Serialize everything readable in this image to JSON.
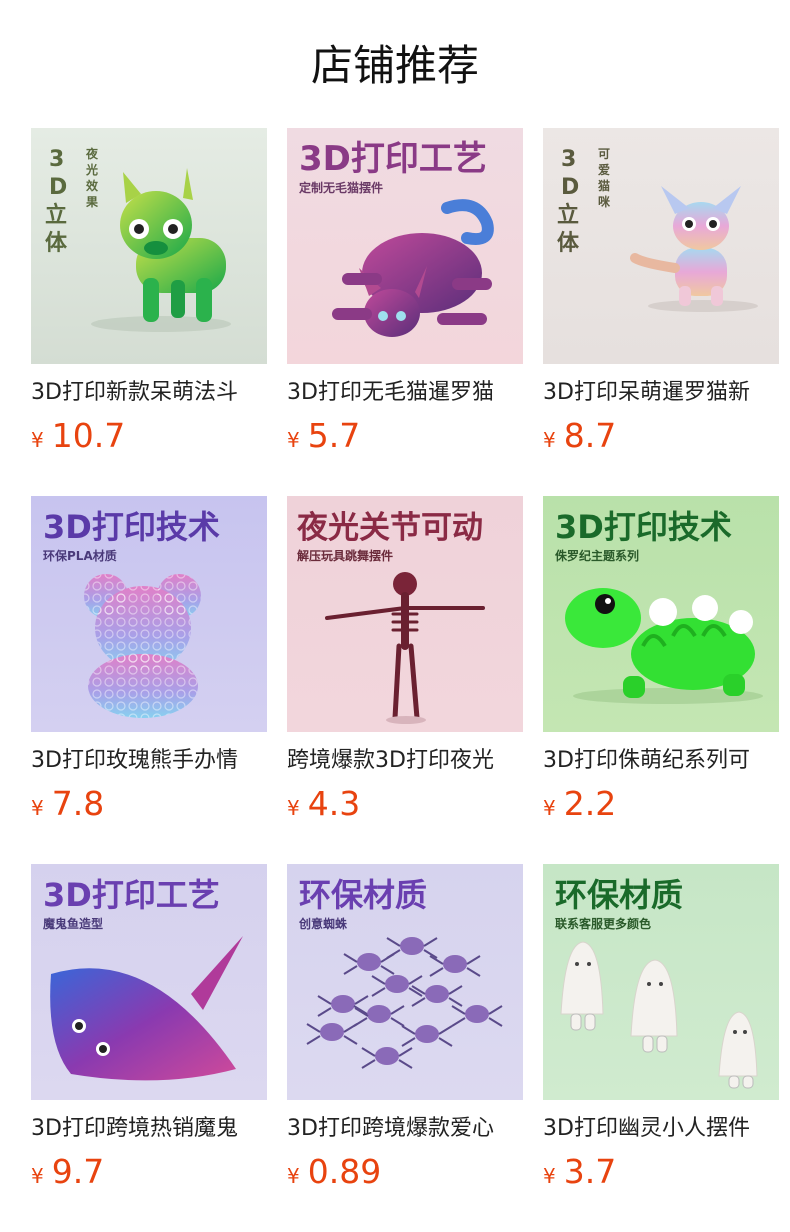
{
  "page": {
    "title": "店铺推荐"
  },
  "products": [
    {
      "name": "3D打印新款呆萌法斗",
      "currency": "¥",
      "price": "10.7",
      "image": {
        "vertical_big": "3D立体",
        "vertical_small": "夜光效果",
        "background": "#dfe7df",
        "subject": "green-french-bulldog"
      }
    },
    {
      "name": "3D打印无毛猫暹罗猫",
      "currency": "¥",
      "price": "5.7",
      "image": {
        "headline": "3D打印工艺",
        "subline": "定制无毛猫摆件",
        "background": "#f1d9df",
        "subject": "purple-hairless-cat"
      }
    },
    {
      "name": "3D打印呆萌暹罗猫新",
      "currency": "¥",
      "price": "8.7",
      "image": {
        "vertical_big": "3D立体",
        "vertical_small": "可爱猫咪",
        "background": "#ece6e4",
        "subject": "pastel-kitten"
      }
    },
    {
      "name": "3D打印玫瑰熊手办情",
      "currency": "¥",
      "price": "7.8",
      "image": {
        "headline": "3D打印技术",
        "subline": "环保PLA材质",
        "background": "#c6c2ec",
        "subject": "rose-bear"
      }
    },
    {
      "name": "跨境爆款3D打印夜光",
      "currency": "¥",
      "price": "4.3",
      "image": {
        "headline": "夜光关节可动",
        "subline": "解压玩具跳舞摆件",
        "background": "#f0cfd6",
        "subject": "skeleton"
      }
    },
    {
      "name": "3D打印侏萌纪系列可",
      "currency": "¥",
      "price": "2.2",
      "image": {
        "headline": "3D打印技术",
        "subline": "侏罗纪主题系列",
        "background": "#bfe3b0",
        "subject": "green-dinosaur"
      }
    },
    {
      "name": "3D打印跨境热销魔鬼",
      "currency": "¥",
      "price": "9.7",
      "image": {
        "headline": "3D打印工艺",
        "subline": "魔鬼鱼造型",
        "background": "#d7d3ec",
        "subject": "manta-ray"
      }
    },
    {
      "name": "3D打印跨境爆款爱心",
      "currency": "¥",
      "price": "0.89",
      "image": {
        "headline": "环保材质",
        "subline": "创意蜘蛛",
        "background": "#d6d3ec",
        "subject": "spiders"
      }
    },
    {
      "name": "3D打印幽灵小人摆件",
      "currency": "¥",
      "price": "3.7",
      "image": {
        "headline": "环保材质",
        "subline": "联系客服更多颜色",
        "background": "#c9e7c8",
        "subject": "ghost-figures"
      }
    }
  ],
  "colors": {
    "price": "#e8430f",
    "headline_purple": "#6a3fb0",
    "headline_plum": "#8a3a86",
    "headline_wine": "#8a2a45",
    "headline_green": "#1a6a2a",
    "vertical_text": "#5a6a3e"
  }
}
